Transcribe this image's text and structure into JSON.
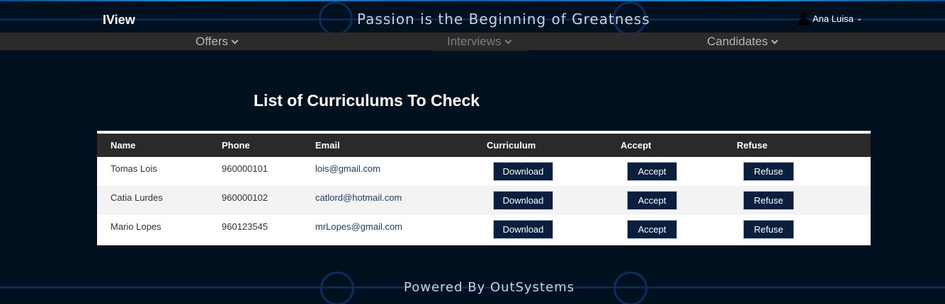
{
  "header": {
    "brand": "IView",
    "tagline": "Passion is the Beginning of Greatness",
    "user_name": "Ana Luisa",
    "user_icon": "user-icon",
    "chevron": "chevron-down-icon"
  },
  "nav": {
    "items": [
      {
        "label": "Offers",
        "active": false
      },
      {
        "label": "Interviews",
        "active": true
      },
      {
        "label": "Candidates",
        "active": false
      }
    ]
  },
  "main": {
    "title": "List of Curriculums To Check",
    "table": {
      "headers": [
        "Name",
        "Phone",
        "Email",
        "Curriculum",
        "Accept",
        "Refuse"
      ],
      "rows": [
        {
          "name": "Tomas Lois",
          "phone": "960000101",
          "email": "lois@gmail.com",
          "curriculum": "Download",
          "accept": "Accept",
          "refuse": "Refuse"
        },
        {
          "name": "Catia Lurdes",
          "phone": "960000102",
          "email": "catlord@hotmail.com",
          "curriculum": "Download",
          "accept": "Accept",
          "refuse": "Refuse"
        },
        {
          "name": "Mario Lopes",
          "phone": "960123545",
          "email": "mrLopes@gmail.com",
          "curriculum": "Download",
          "accept": "Accept",
          "refuse": "Refuse"
        }
      ]
    }
  },
  "footer": {
    "text": "Powered By OutSystems"
  },
  "colors": {
    "background": "#01101f",
    "nav_bar": "#2b2b2b",
    "table_header": "#2b2a28",
    "button": "#0a1f40",
    "link": "#1c3d6e"
  }
}
